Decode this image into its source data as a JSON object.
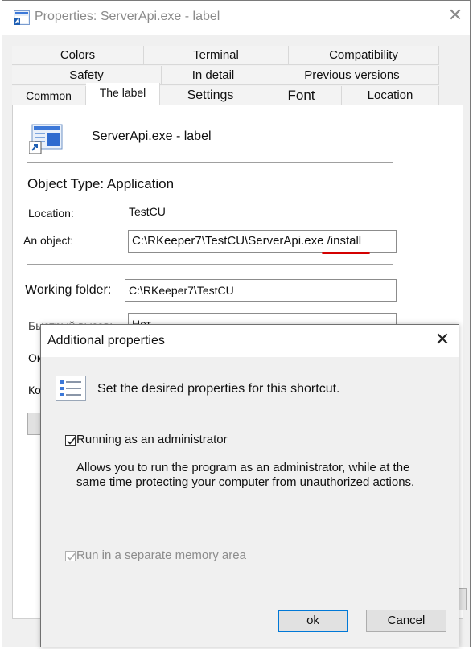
{
  "window": {
    "title": "Properties: ServerApi.exe - label"
  },
  "tabs_row1": [
    "Colors",
    "Terminal",
    "Compatibility"
  ],
  "tabs_row2": [
    "Safety",
    "In detail",
    "Previous versions"
  ],
  "tabs_row3": [
    "Common",
    "The label",
    "Settings",
    "Font",
    "Location"
  ],
  "shortcut": {
    "name": "ServerApi.exe - label",
    "object_type": "Object Type: Application",
    "location_label": "Location:",
    "location_value": "TestCU",
    "object_label": "An object:",
    "object_value": "C:\\RKeeper7\\TestCU\\ServerApi.exe /install",
    "working_folder_label": "Working folder:",
    "working_folder_value": "C:\\RKeeper7\\TestCU",
    "hotkey_label": "Быстрый вызов:",
    "hotkey_value": "Нет",
    "window_label_partial": "Ок",
    "comment_label_partial": "Ко",
    "button_partial": "Р"
  },
  "dialog": {
    "title": "Additional properties",
    "header": "Set the desired properties for this shortcut.",
    "option1_label": "Running as an administrator",
    "option1_checked": true,
    "option1_desc": "Allows you to run the program as an administrator, while at the same time protecting your computer from unauthorized actions.",
    "option2_label": "Run in a separate memory area",
    "option2_checked": true,
    "ok_label": "ok",
    "cancel_label": "Cancel"
  },
  "colors": {
    "accent": "#0078d7",
    "underline": "#d40000"
  },
  "icons": {
    "title_icon": "shortcut-app-icon",
    "close": "close-icon",
    "dialog_icon": "checklist-icon"
  }
}
